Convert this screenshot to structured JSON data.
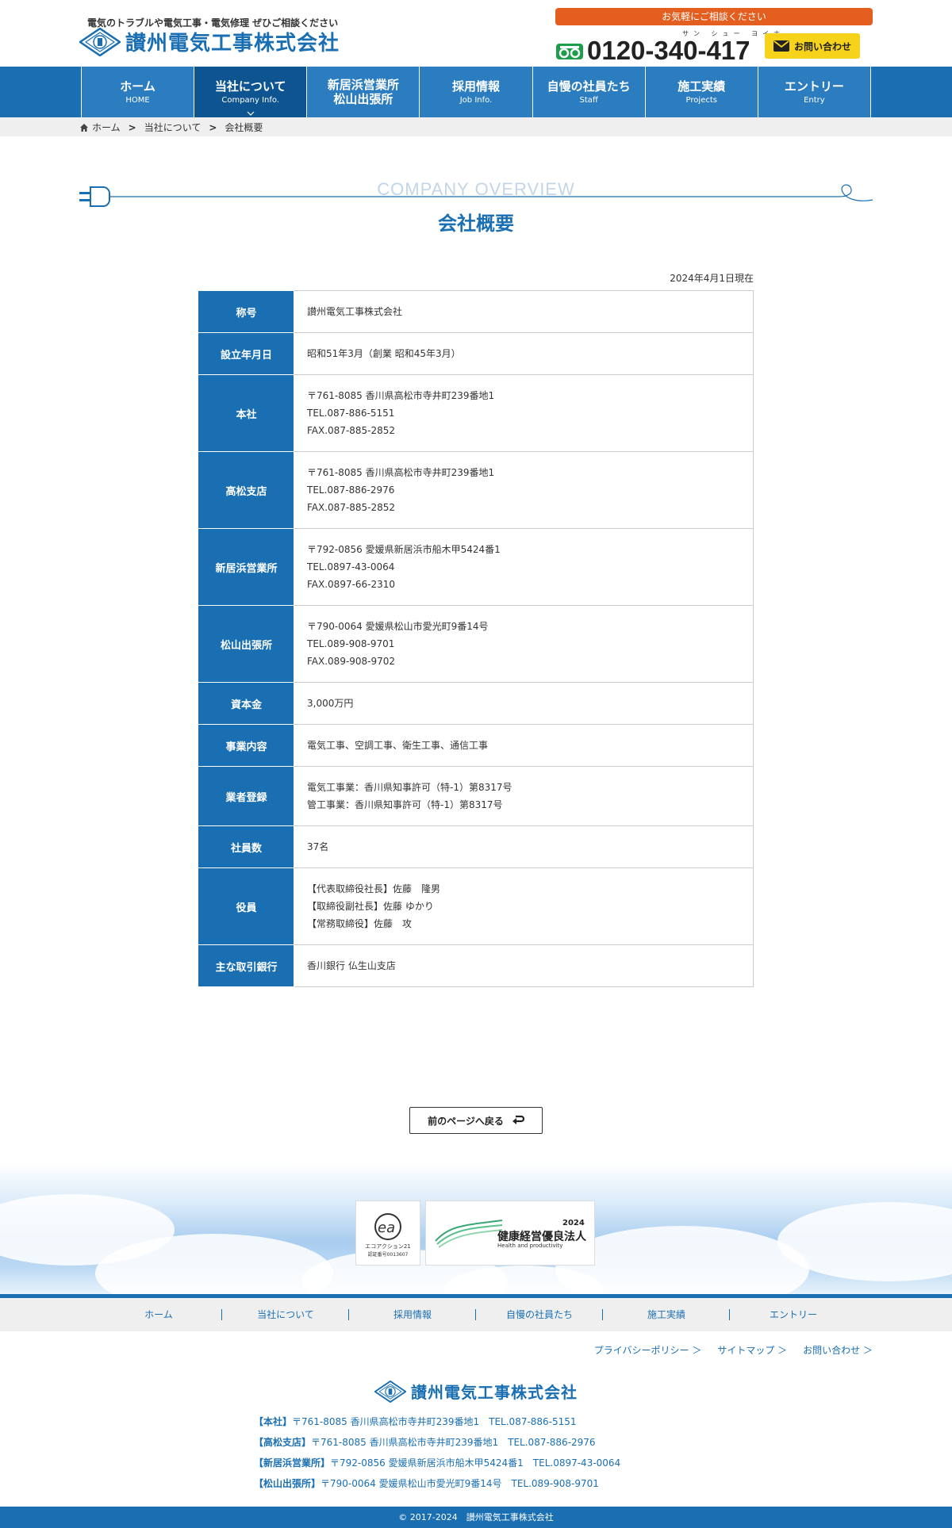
{
  "header": {
    "tagline": "電気のトラブルや電気工事・電気修理 ぜひご相談ください",
    "company_name": "讃州電気工事株式会社",
    "consult_label": "お気軽にご相談ください",
    "phone_kana": "サン シュー ヨイナ",
    "phone_number": "0120-340-417",
    "contact_label": "お問い合わせ"
  },
  "nav": {
    "items": [
      {
        "jp": "ホーム",
        "en": "HOME"
      },
      {
        "jp": "当社について",
        "en": "Company Info."
      },
      {
        "jp": "新居浜営業所",
        "jp2": "松山出張所",
        "en": ""
      },
      {
        "jp": "採用情報",
        "en": "Job Info."
      },
      {
        "jp": "自慢の社員たち",
        "en": "Staff"
      },
      {
        "jp": "施工実績",
        "en": "Projects"
      },
      {
        "jp": "エントリー",
        "en": "Entry"
      }
    ]
  },
  "breadcrumb": [
    "ホーム",
    "当社について",
    "会社概要"
  ],
  "title": {
    "en": "COMPANY OVERVIEW",
    "jp": "会社概要"
  },
  "as_of": "2024年4月1日現在",
  "table": {
    "rows": [
      {
        "label": "称号",
        "lines": [
          "讃州電気工事株式会社"
        ]
      },
      {
        "label": "設立年月日",
        "lines": [
          "昭和51年3月（創業 昭和45年3月）"
        ]
      },
      {
        "label": "本社",
        "lines": [
          "〒761-8085 香川県高松市寺井町239番地1",
          "TEL.087-886-5151",
          "FAX.087-885-2852"
        ]
      },
      {
        "label": "高松支店",
        "lines": [
          "〒761-8085 香川県高松市寺井町239番地1",
          "TEL.087-886-2976",
          "FAX.087-885-2852"
        ]
      },
      {
        "label": "新居浜営業所",
        "lines": [
          "〒792-0856 愛媛県新居浜市船木甲5424番1",
          "TEL.0897-43-0064",
          "FAX.0897-66-2310"
        ]
      },
      {
        "label": "松山出張所",
        "lines": [
          "〒790-0064 愛媛県松山市愛光町9番14号",
          "TEL.089-908-9701",
          "FAX.089-908-9702"
        ]
      },
      {
        "label": "資本金",
        "lines": [
          "3,000万円"
        ]
      },
      {
        "label": "事業内容",
        "lines": [
          "電気工事、空調工事、衛生工事、通信工事"
        ]
      },
      {
        "label": "業者登録",
        "lines": [
          "電気工事業：香川県知事許可（特-1）第8317号",
          "管工事業：香川県知事許可（特-1）第8317号"
        ]
      },
      {
        "label": "社員数",
        "lines": [
          "37名"
        ]
      },
      {
        "label": "役員",
        "lines": [
          "【代表取締役社長】佐藤　隆男",
          "【取締役副社長】佐藤 ゆかり",
          "【常務取締役】佐藤　攻"
        ]
      },
      {
        "label": "主な取引銀行",
        "lines": [
          "香川銀行 仏生山支店"
        ]
      }
    ]
  },
  "back_button": "前のページへ戻る",
  "badges": {
    "eco_line1": "エコアクション21",
    "eco_line2": "認証番号0013607",
    "health_year": "2024",
    "health_name": "健康経営優良法人",
    "health_sub": "Health and productivity"
  },
  "footer": {
    "nav": [
      "ホーム",
      "当社について",
      "採用情報",
      "自慢の社員たち",
      "施工実績",
      "エントリー"
    ],
    "links": [
      "プライバシーポリシー ＞",
      "サイトマップ ＞",
      "お問い合わせ ＞"
    ],
    "company_name": "讃州電気工事株式会社",
    "offices": [
      {
        "name": "【本社】",
        "info": "〒761-8085 香川県高松市寺井町239番地1　TEL.087-886-5151"
      },
      {
        "name": "【高松支店】",
        "info": "〒761-8085 香川県高松市寺井町239番地1　TEL.087-886-2976"
      },
      {
        "name": "【新居浜営業所】",
        "info": "〒792-0856 愛媛県新居浜市船木甲5424番1　TEL.0897-43-0064"
      },
      {
        "name": "【松山出張所】",
        "info": "〒790-0064 愛媛県松山市愛光町9番14号　TEL.089-908-9701"
      }
    ],
    "copyright": "© 2017-2024　讃州電気工事株式会社"
  },
  "colors": {
    "brand_blue": "#1a6fb3",
    "nav_active": "#0d5490",
    "accent_orange": "#e35e1f",
    "contact_yellow": "#f7d21a"
  }
}
